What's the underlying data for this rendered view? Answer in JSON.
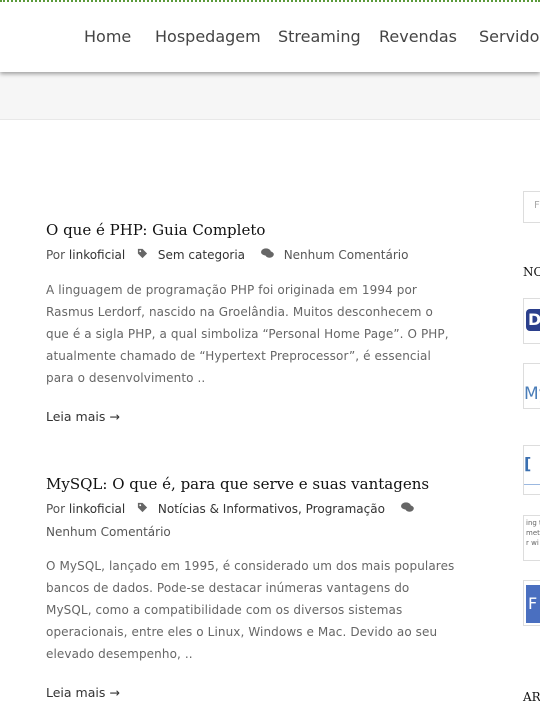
{
  "nav": {
    "items": [
      "Home",
      "Hospedagem",
      "Streaming",
      "Revendas",
      "Servidores"
    ]
  },
  "posts": [
    {
      "title": "O que é PHP: Guia Completo",
      "by_label": "Por",
      "author": "linkoficial",
      "categories": [
        "Sem categoria"
      ],
      "comments": "Nenhum Comentário",
      "excerpt": "A linguagem de programação PHP foi originada em 1994 por Rasmus Lerdorf, nascido na Groelândia. Muitos desconhecem o que é a sigla PHP, a qual simboliza “Personal Home Page”. O PHP, atualmente chamado de “Hypertext Preprocessor”, é essencial para o desenvolvimento ..",
      "read_more": "Leia mais →"
    },
    {
      "title": "MySQL: O que é, para que serve e suas vantagens",
      "by_label": "Por",
      "author": "linkoficial",
      "categories": [
        "Notícias & Informativos",
        "Programação"
      ],
      "comments": "Nenhum Comentário",
      "excerpt": "O MySQL, lançado em 1995, é considerado um dos mais populares bancos de dados. Pode-se destacar inúmeras vantagens do MySQL, como a compatibilidade com os diversos sistemas operacionais, entre eles o Linux, Windows e Mac. Devido ao seu elevado desempenho, ..",
      "read_more": "Leia mais →"
    }
  ],
  "sidebar": {
    "search_placeholder": "F",
    "heading_1": "NO",
    "heading_2": "AR",
    "thumbs": [
      {
        "label": "D",
        "color": "#2b3f8c"
      },
      {
        "label": "My",
        "color": "#4a7db8"
      },
      {
        "label": "[",
        "color": "#3a6fb0"
      },
      {
        "label": "ing t\nmet\nr wi",
        "color": "#777777"
      },
      {
        "label": "F",
        "color": "#4a6fc0"
      }
    ]
  },
  "colors": {
    "accent_border": "#5a9a3a",
    "title": "#111111",
    "text": "#666666"
  }
}
